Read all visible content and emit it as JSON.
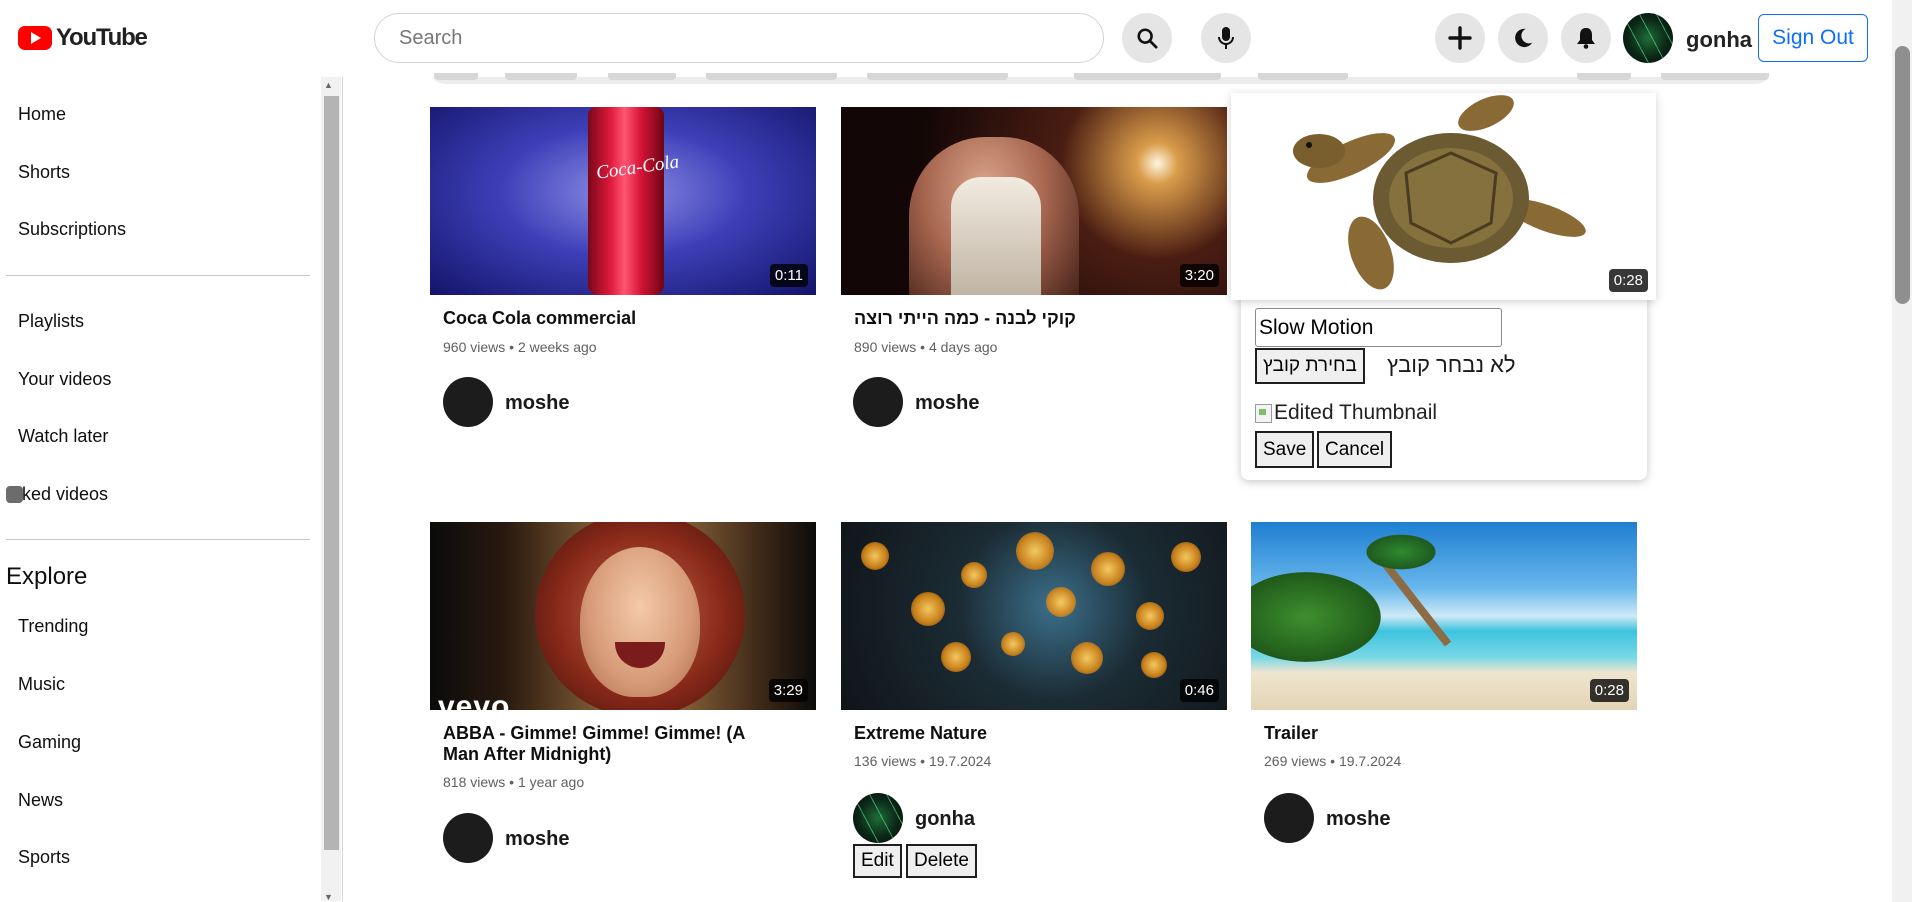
{
  "header": {
    "logo_text": "YouTube",
    "search": {
      "placeholder": "Search",
      "value": ""
    },
    "icons": [
      "search-icon",
      "microphone-icon",
      "plus-icon",
      "moon-icon",
      "bell-icon"
    ],
    "username": "gonha",
    "sign_out_label": "Sign Out",
    "accent": "#0d6efd",
    "brand_red": "#ff0000"
  },
  "sidebar": {
    "items": [
      {
        "label": "Home"
      },
      {
        "label": "Shorts"
      },
      {
        "label": "Subscriptions"
      },
      {
        "label": "Playlists"
      },
      {
        "label": "Your videos"
      },
      {
        "label": "Watch later"
      },
      {
        "label": "iked videos"
      }
    ],
    "explore_heading": "Explore",
    "explore_items": [
      {
        "label": "Trending"
      },
      {
        "label": "Music"
      },
      {
        "label": "Gaming"
      },
      {
        "label": "News"
      },
      {
        "label": "Sports"
      }
    ]
  },
  "videos": [
    {
      "title": "Coca Cola commercial",
      "views": "960 views",
      "date": "2 weeks ago",
      "duration": "0:11",
      "author": "moshe",
      "thumb_text": "Coca-Cola"
    },
    {
      "title": "קוקי לבנה - כמה הייתי רוצה",
      "views": "890 views",
      "date": "4 days ago",
      "duration": "3:20",
      "author": "moshe"
    },
    {
      "title": "ABBA - Gimme! Gimme! Gimme! (A Man After Midnight)",
      "views": "818 views",
      "date": "1 year ago",
      "duration": "3:29",
      "author": "moshe",
      "thumb_text": "vevo"
    },
    {
      "title": "Extreme Nature",
      "views": "136 views",
      "date": "19.7.2024",
      "duration": "0:46",
      "author": "gonha",
      "edit_label": "Edit",
      "delete_label": "Delete"
    },
    {
      "title": "Trailer",
      "views": "269 views",
      "date": "19.7.2024",
      "duration": "0:28",
      "author": "moshe"
    }
  ],
  "meta_separator": "•",
  "edit_popup": {
    "preview_duration": "0:28",
    "title_value": "Slow Motion",
    "file_button_label": "בחירת קובץ",
    "file_status": "לא נבחר קובץ",
    "thumbnail_alt": "Edited Thumbnail",
    "save_label": "Save",
    "cancel_label": "Cancel"
  }
}
